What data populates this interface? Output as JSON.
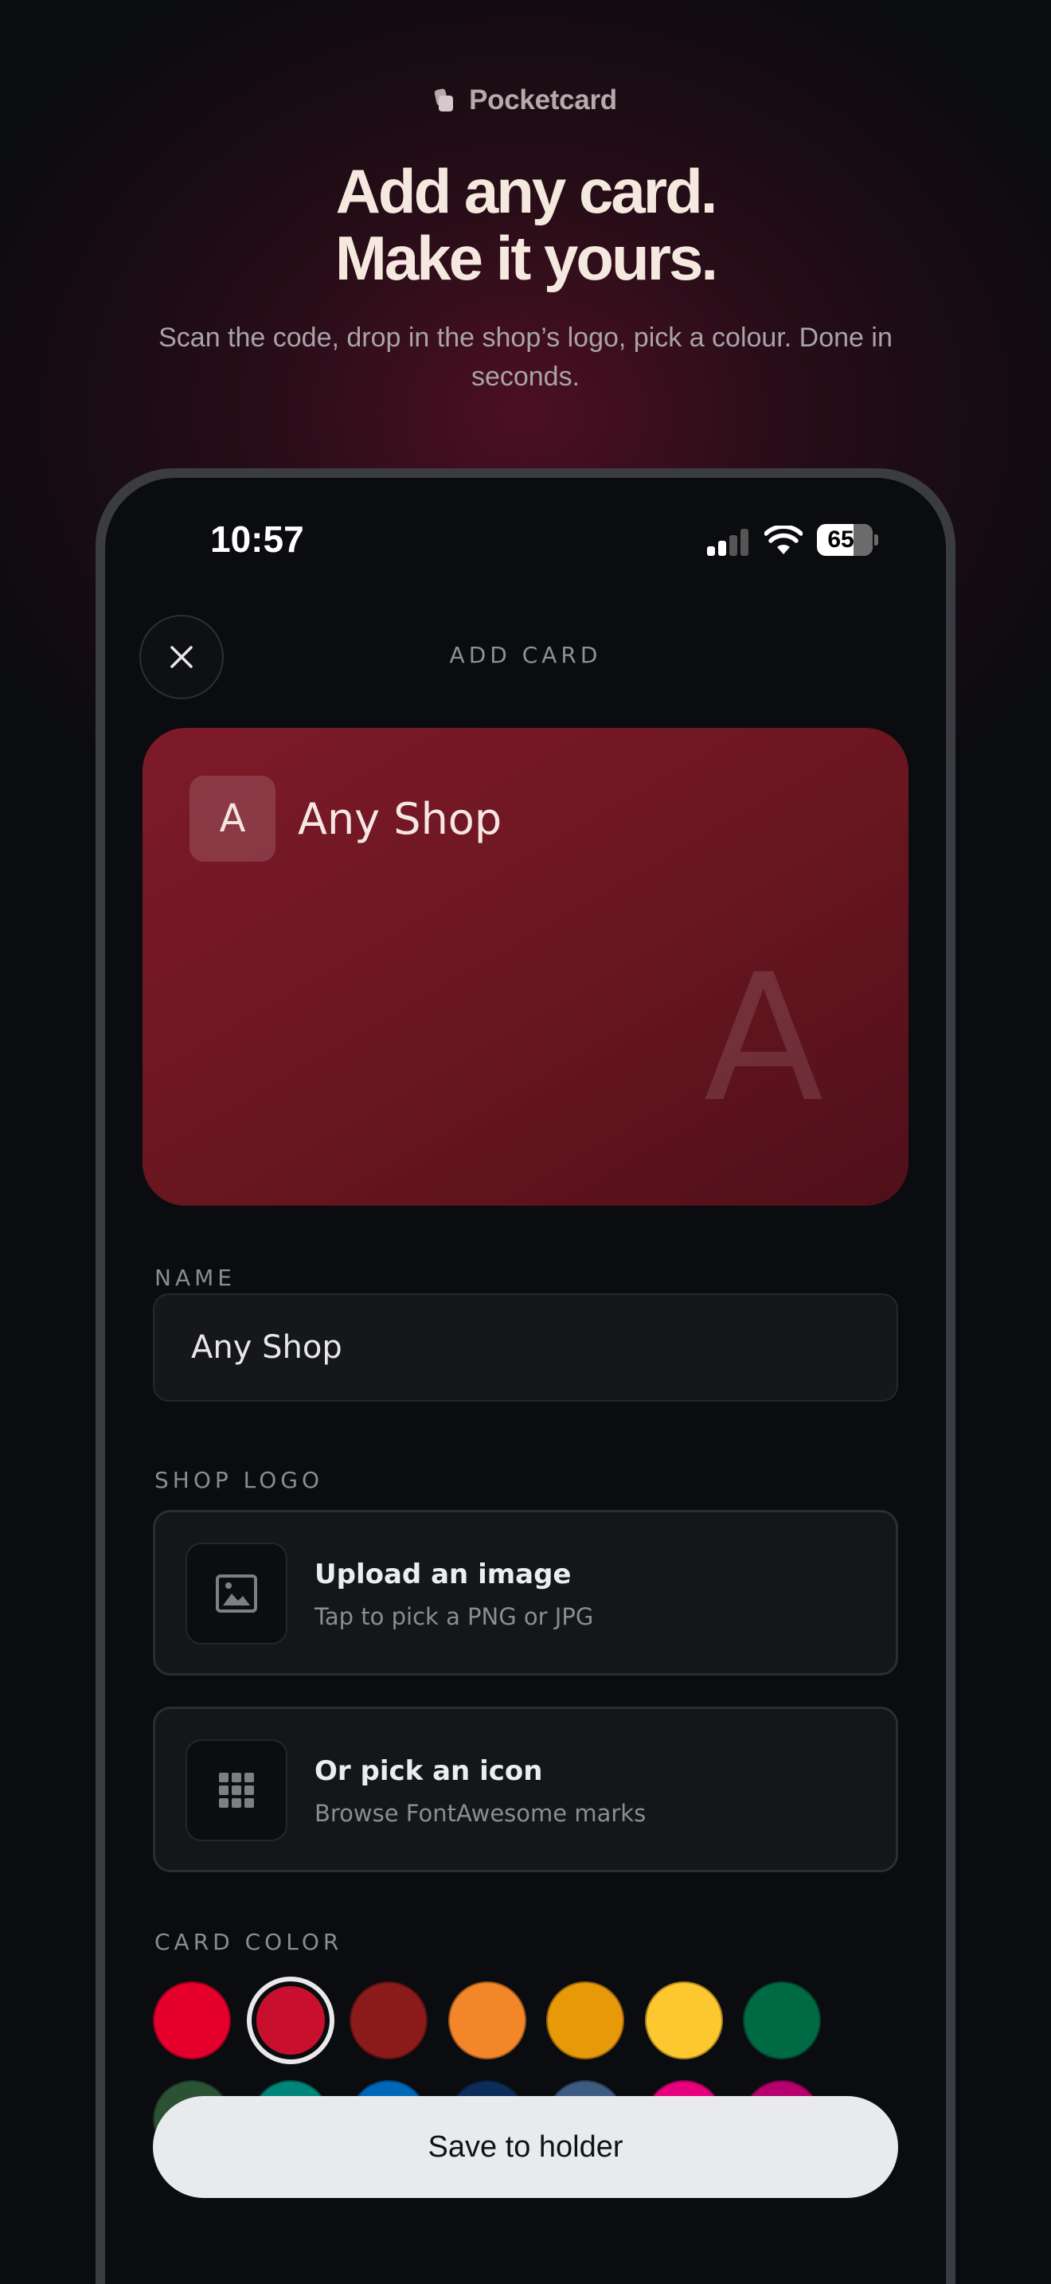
{
  "brand": {
    "name": "Pocketcard"
  },
  "hero": {
    "headline_line1": "Add any card.",
    "headline_line2": "Make it yours.",
    "subtitle": "Scan the code, drop in the shop’s logo, pick a colour. Done in seconds."
  },
  "status_bar": {
    "time": "10:57",
    "battery": "65"
  },
  "sheet": {
    "title": "ADD CARD",
    "close_icon": "close-icon"
  },
  "card_preview": {
    "initial": "A",
    "name": "Any Shop",
    "watermark": "A",
    "color": "#7e1a2a"
  },
  "name_field": {
    "label": "NAME",
    "value": "Any Shop"
  },
  "shop_logo": {
    "label": "SHOP LOGO",
    "upload": {
      "title": "Upload an image",
      "subtitle": "Tap to pick a PNG or JPG",
      "icon": "image-icon"
    },
    "icon_pick": {
      "title": "Or pick an icon",
      "subtitle": "Browse FontAwesome marks",
      "icon": "grid-icon"
    }
  },
  "card_color": {
    "label": "CARD COLOR",
    "selected_index": 1,
    "row1": [
      "#e4002b",
      "#c8102e",
      "#8b1a1a",
      "#f4862a",
      "#e8990a",
      "#fdc82f",
      "#006a44"
    ],
    "row2": [
      "#2c5234",
      "#00857a",
      "#0067b8",
      "#0c2d5a",
      "#3d5a80",
      "#e6007e",
      "#b5006e"
    ]
  },
  "save_button": {
    "label": "Save to holder"
  }
}
